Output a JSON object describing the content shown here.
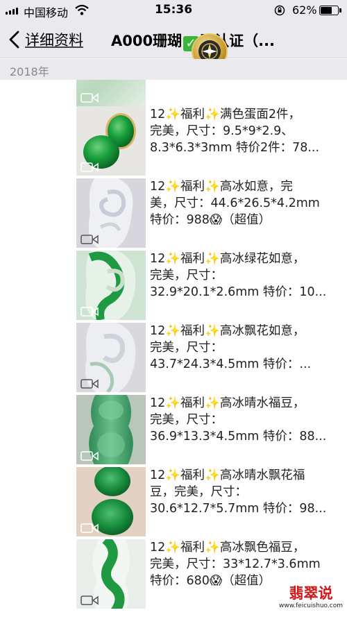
{
  "status_bar": {
    "carrier": "中国移动",
    "time": "15:36",
    "battery": "62%",
    "battery_level": 0.62
  },
  "nav": {
    "back_label": "详细资料",
    "title_prefix": "A000珊瑚",
    "title_suffix": "已认证（..."
  },
  "year_header": "2018年",
  "items": [
    {
      "lines": [
        "",
        "",
        ""
      ]
    },
    {
      "lines": [
        "12✨福利✨满色蛋面2件，",
        "完美，尺寸：9.5*9*2.9、",
        "8.3*6.3*3mm 特价2件：78..."
      ]
    },
    {
      "lines": [
        "12✨福利✨高冰如意，完",
        "美，尺寸：44.6*26.5*4.2mm",
        "特价：988😱（超值）"
      ]
    },
    {
      "lines": [
        "12✨福利✨高冰绿花如意，",
        "完美，尺寸：",
        "32.9*20.1*2.6mm 特价：10..."
      ]
    },
    {
      "lines": [
        "12✨福利✨高冰飘花如意，",
        "完美，尺寸：",
        "43.7*24.3*4.5mm 特价：..."
      ]
    },
    {
      "lines": [
        "12✨福利✨高冰晴水福豆，",
        "完美，尺寸：",
        "36.9*13.3*4.5mm 特价：88..."
      ]
    },
    {
      "lines": [
        "12✨福利✨高冰晴水飘花福",
        "豆，完美，尺寸：",
        "30.6*12.7*5.7mm 特价：98..."
      ]
    },
    {
      "lines": [
        "12✨福利✨高冰飘色福豆，",
        "完美，尺寸：33*12.7*3.6mm",
        "特价：680😱（超值）"
      ]
    }
  ],
  "watermark": {
    "title": "翡翠说",
    "url": "www.feicuishuo.com"
  },
  "colors": {
    "header_bg": "#e9e9ee",
    "jade_green": "#1f8a3a",
    "watermark_red": "#d01818"
  }
}
